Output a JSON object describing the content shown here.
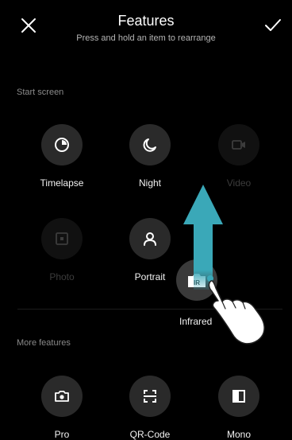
{
  "header": {
    "title": "Features",
    "subtitle": "Press and hold an item to rearrange",
    "close_icon": "close-icon",
    "confirm_icon": "check-icon"
  },
  "start_screen": {
    "label": "Start screen",
    "items": [
      {
        "label": "Timelapse",
        "icon": "timelapse-icon",
        "enabled": true
      },
      {
        "label": "Night",
        "icon": "moon-icon",
        "enabled": true
      },
      {
        "label": "Video",
        "icon": "video-icon",
        "enabled": false
      },
      {
        "label": "Photo",
        "icon": "photo-icon",
        "enabled": false
      },
      {
        "label": "Portrait",
        "icon": "portrait-icon",
        "enabled": true
      }
    ]
  },
  "dragging": {
    "label": "Infrared",
    "icon": "infrared-icon",
    "badge": "IR"
  },
  "more_features": {
    "label": "More features",
    "items": [
      {
        "label": "Pro",
        "icon": "camera-icon"
      },
      {
        "label": "QR-Code",
        "icon": "qr-scan-icon"
      },
      {
        "label": "Mono",
        "icon": "mono-icon"
      }
    ]
  },
  "colors": {
    "background": "#000000",
    "tile": "#2a2a2a",
    "arrow": "#3aa8b8"
  },
  "gesture": {
    "arrow_direction": "up",
    "hand_icon": "hand-pointer-icon"
  }
}
